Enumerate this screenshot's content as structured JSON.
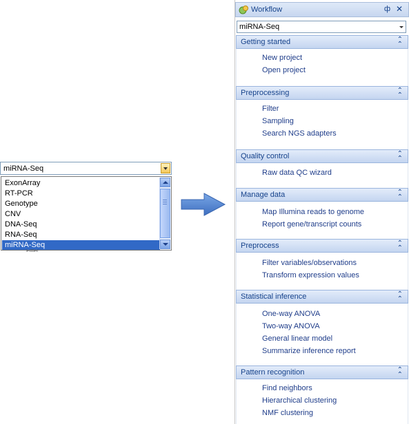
{
  "dropdown": {
    "value": "miRNA-Seq",
    "options": [
      "ExonArray",
      "RT-PCR",
      "Genotype",
      "CNV",
      "DNA-Seq",
      "RNA-Seq",
      "miRNA-Seq"
    ],
    "peek_text": "Filter"
  },
  "arrow_icon": "right-arrow-icon",
  "panel": {
    "title": "Workflow",
    "combo_value": "miRNA-Seq",
    "sections": [
      {
        "title": "Getting started",
        "items": [
          "New project",
          "Open project"
        ]
      },
      {
        "title": "Preprocessing",
        "items": [
          "Filter",
          "Sampling",
          "Search NGS adapters"
        ]
      },
      {
        "title": "Quality control",
        "items": [
          "Raw data QC wizard"
        ]
      },
      {
        "title": "Manage data",
        "items": [
          "Map Illumina reads to genome",
          "Report gene/transcript counts"
        ]
      },
      {
        "title": "Preprocess",
        "items": [
          "Filter variables/observations",
          "Transform expression values"
        ]
      },
      {
        "title": "Statistical inference",
        "items": [
          "One-way ANOVA",
          "Two-way ANOVA",
          "General linear model",
          "Summarize inference report"
        ]
      },
      {
        "title": "Pattern recognition",
        "items": [
          "Find neighbors",
          "Hierarchical clustering",
          "NMF clustering"
        ]
      }
    ]
  },
  "colors": {
    "selection": "#3169c6",
    "link": "#1f3d8a",
    "header_text": "#15428b",
    "arrow": "#4a7fd0"
  }
}
